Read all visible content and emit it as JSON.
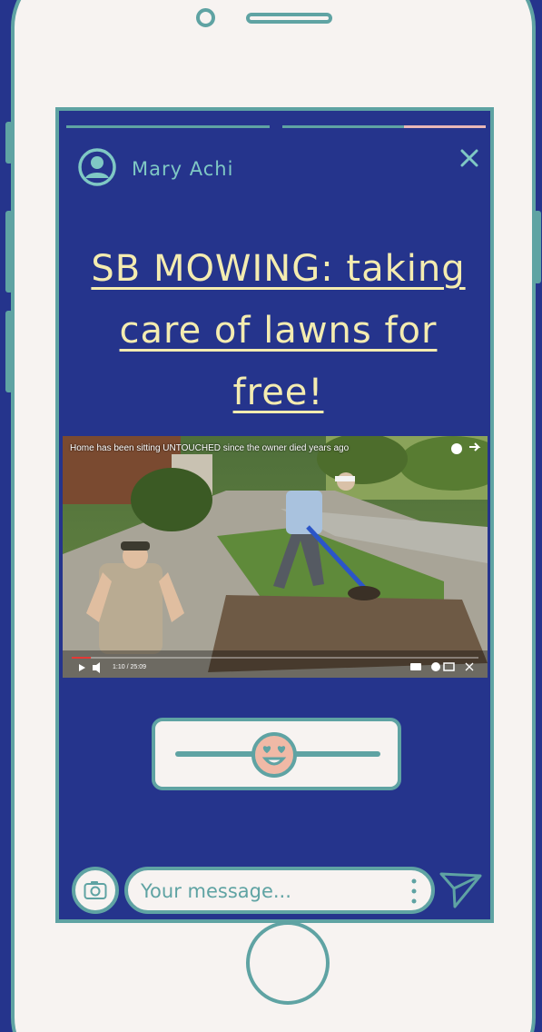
{
  "story": {
    "username": "Mary Achi",
    "headline": "SB MOWING: taking care of lawns for free!"
  },
  "video": {
    "title": "Home has been sitting UNTOUCHED since the owner died years ago",
    "time": "1:10 / 25:09",
    "progress": 0.047
  },
  "story_progress": [
    1.0,
    0.6
  ],
  "reaction": {
    "emoji": "heart-eyes",
    "level": 0.5
  },
  "composer": {
    "placeholder": "Your message..."
  },
  "colors": {
    "background": "#25348c",
    "phone": "#f7f3f1",
    "accent": "#5fa3a3",
    "headline": "#f4ecb0",
    "username": "#7fc8c4",
    "emoji": "#f0b9a6"
  },
  "icons": {
    "avatar": "user-circle-icon",
    "close": "close-icon",
    "camera": "camera-icon",
    "more": "vertical-dots-icon",
    "send": "send-icon"
  }
}
